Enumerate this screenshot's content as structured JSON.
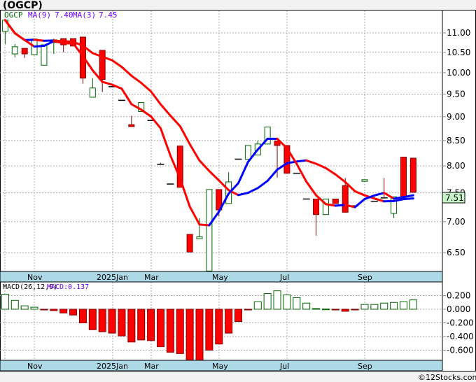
{
  "header": {
    "title": "(OGCP)",
    "copyright": "©12Stocks.com"
  },
  "legend": {
    "symbol": "OGCP",
    "ma9_label": "MA(9)",
    "ma9_value": "7.40",
    "ma3_label": "MA(3)",
    "ma3_value": "7.45",
    "macd_label": "MACD(26,12,9)",
    "macd_value": "MACD:0.137",
    "last_price": "7.51"
  },
  "colors": {
    "up": "#006400",
    "down": "#ff0000",
    "ma_rising": "#0000ff",
    "ma_falling": "#ff0000",
    "axis_band": "#add8e6",
    "last_price_bg": "#c8f5c8",
    "legend_symbol": "#006400",
    "legend_ma": "#6a00ff"
  },
  "chart_data": [
    {
      "type": "candlestick",
      "title": "(OGCP)",
      "scale": "log",
      "ylim": [
        6.2,
        11.45
      ],
      "grid": true,
      "y_ticks": [
        "11.00",
        "10.50",
        "10.00",
        "9.50",
        "9.00",
        "8.50",
        "8.00",
        "7.50",
        "7.00",
        "6.50"
      ],
      "x_ticks": [
        "Nov",
        "2025Jan",
        "Mar",
        "May",
        "Jul",
        "Sep"
      ],
      "ohlc": [
        [
          11.04,
          11.34,
          10.71,
          11.34
        ],
        [
          10.46,
          10.71,
          10.37,
          10.64
        ],
        [
          10.6,
          10.6,
          10.36,
          10.46
        ],
        [
          10.44,
          10.84,
          10.44,
          10.84
        ],
        [
          10.18,
          10.69,
          10.18,
          10.69
        ],
        [
          10.75,
          10.85,
          10.46,
          10.82
        ],
        [
          10.85,
          10.85,
          10.5,
          10.69
        ],
        [
          10.85,
          10.85,
          10.66,
          10.66
        ],
        [
          10.89,
          10.89,
          9.74,
          9.87
        ],
        [
          9.43,
          9.87,
          9.43,
          9.64
        ],
        [
          10.55,
          10.55,
          9.55,
          9.84
        ],
        [
          9.67,
          9.67,
          9.67,
          9.67
        ],
        [
          9.36,
          9.36,
          9.36,
          9.36
        ],
        [
          8.83,
          9.02,
          8.79,
          8.79
        ],
        [
          9.11,
          9.31,
          9.11,
          9.31
        ],
        [
          8.92,
          8.92,
          8.92,
          8.92
        ],
        [
          8.03,
          8.06,
          8.03,
          8.03
        ],
        [
          7.66,
          7.66,
          7.66,
          7.66
        ],
        [
          8.39,
          8.39,
          7.6,
          7.6
        ],
        [
          6.79,
          6.79,
          6.51,
          6.51
        ],
        [
          6.72,
          7.06,
          6.72,
          6.75
        ],
        [
          6.22,
          7.56,
          6.0,
          7.56
        ],
        [
          7.56,
          7.56,
          7.09,
          7.2
        ],
        [
          7.31,
          7.88,
          7.31,
          7.7
        ],
        [
          8.13,
          8.13,
          8.13,
          8.13
        ],
        [
          8.13,
          8.4,
          8.13,
          8.4
        ],
        [
          8.21,
          8.5,
          8.21,
          8.43
        ],
        [
          8.43,
          8.78,
          8.43,
          8.78
        ],
        [
          8.49,
          8.49,
          7.78,
          8.4
        ],
        [
          8.4,
          8.4,
          7.86,
          7.86
        ],
        [
          7.86,
          7.86,
          7.86,
          7.86
        ],
        [
          7.39,
          7.39,
          7.39,
          7.39
        ],
        [
          7.39,
          7.39,
          6.77,
          7.12
        ],
        [
          7.12,
          7.39,
          7.12,
          7.39
        ],
        [
          7.39,
          7.39,
          7.31,
          7.31
        ],
        [
          7.63,
          7.77,
          7.16,
          7.16
        ],
        [
          7.27,
          7.27,
          7.27,
          7.27
        ],
        [
          7.71,
          7.74,
          7.71,
          7.74
        ],
        [
          7.35,
          7.35,
          7.35,
          7.35
        ],
        [
          7.41,
          7.77,
          7.22,
          7.41
        ],
        [
          7.14,
          7.43,
          7.06,
          7.43
        ],
        [
          8.17,
          8.17,
          7.43,
          7.43
        ],
        [
          8.15,
          8.15,
          7.51,
          7.51
        ]
      ],
      "series": [
        {
          "name": "MA(9)",
          "window": 9
        },
        {
          "name": "MA(3)",
          "window": 3
        }
      ]
    },
    {
      "type": "bar",
      "title": "MACD(26,12,9)",
      "ylim": [
        -0.75,
        0.3
      ],
      "y_ticks": [
        "0.200",
        "0.000",
        "-0.200",
        "-0.400",
        "-0.600"
      ],
      "x_ticks": [
        "Nov",
        "2025Jan",
        "Mar",
        "May",
        "Jul",
        "Sep"
      ],
      "values": [
        0.22,
        0.13,
        0.05,
        0.03,
        -0.01,
        -0.02,
        -0.055,
        -0.085,
        -0.2,
        -0.3,
        -0.33,
        -0.35,
        -0.39,
        -0.48,
        -0.45,
        -0.46,
        -0.55,
        -0.63,
        -0.65,
        -0.75,
        -0.75,
        -0.6,
        -0.51,
        -0.35,
        -0.18,
        -0.005,
        0.11,
        0.23,
        0.27,
        0.21,
        0.17,
        0.09,
        0.01,
        0.003,
        -0.01,
        -0.03,
        -0.01,
        0.07,
        0.07,
        0.09,
        0.1,
        0.11,
        0.137
      ]
    }
  ]
}
